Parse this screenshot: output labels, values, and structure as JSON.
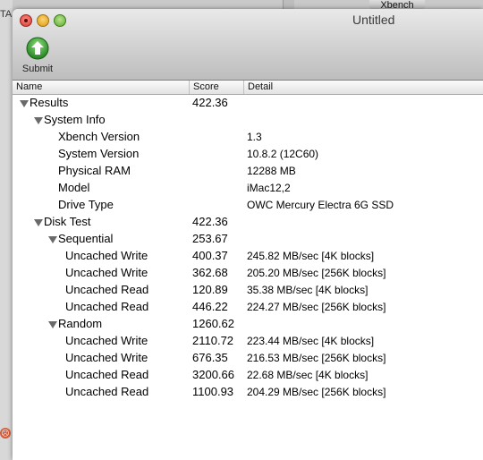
{
  "background": {
    "left_text": "TA",
    "tab_label": "Xbench"
  },
  "window": {
    "title": "Untitled"
  },
  "toolbar": {
    "submit_label": "Submit"
  },
  "columns": {
    "name": "Name",
    "score": "Score",
    "detail": "Detail"
  },
  "rows": [
    {
      "name": "Results",
      "score": "422.36",
      "detail": "",
      "level": 0,
      "expanded": true
    },
    {
      "name": "System Info",
      "score": "",
      "detail": "",
      "level": 1,
      "expanded": true
    },
    {
      "name": "Xbench Version",
      "score": "",
      "detail": "1.3",
      "level": 2
    },
    {
      "name": "System Version",
      "score": "",
      "detail": "10.8.2 (12C60)",
      "level": 2
    },
    {
      "name": "Physical RAM",
      "score": "",
      "detail": "12288 MB",
      "level": 2
    },
    {
      "name": "Model",
      "score": "",
      "detail": "iMac12,2",
      "level": 2
    },
    {
      "name": "Drive Type",
      "score": "",
      "detail": "OWC Mercury Electra 6G SSD",
      "level": 2
    },
    {
      "name": "Disk Test",
      "score": "422.36",
      "detail": "",
      "level": 1,
      "expanded": true
    },
    {
      "name": "Sequential",
      "score": "253.67",
      "detail": "",
      "level": 2,
      "expanded": true
    },
    {
      "name": "Uncached Write",
      "score": "400.37",
      "detail": "245.82 MB/sec [4K blocks]",
      "level": 3
    },
    {
      "name": "Uncached Write",
      "score": "362.68",
      "detail": "205.20 MB/sec [256K blocks]",
      "level": 3
    },
    {
      "name": "Uncached Read",
      "score": "120.89",
      "detail": "35.38 MB/sec [4K blocks]",
      "level": 3
    },
    {
      "name": "Uncached Read",
      "score": "446.22",
      "detail": "224.27 MB/sec [256K blocks]",
      "level": 3
    },
    {
      "name": "Random",
      "score": "1260.62",
      "detail": "",
      "level": 2,
      "expanded": true
    },
    {
      "name": "Uncached Write",
      "score": "2110.72",
      "detail": "223.44 MB/sec [4K blocks]",
      "level": 3
    },
    {
      "name": "Uncached Write",
      "score": "676.35",
      "detail": "216.53 MB/sec [256K blocks]",
      "level": 3
    },
    {
      "name": "Uncached Read",
      "score": "3200.66",
      "detail": "22.68 MB/sec [4K blocks]",
      "level": 3
    },
    {
      "name": "Uncached Read",
      "score": "1100.93",
      "detail": "204.29 MB/sec [256K blocks]",
      "level": 3
    }
  ],
  "icons": {
    "submit": "green-up-arrow-icon",
    "disclosure": "disclosure-triangle-icon"
  },
  "colors": {
    "submit_green": "#2f9a2a",
    "close": "#d4342b",
    "minimize": "#d99b15",
    "maximize": "#5ea92f"
  }
}
